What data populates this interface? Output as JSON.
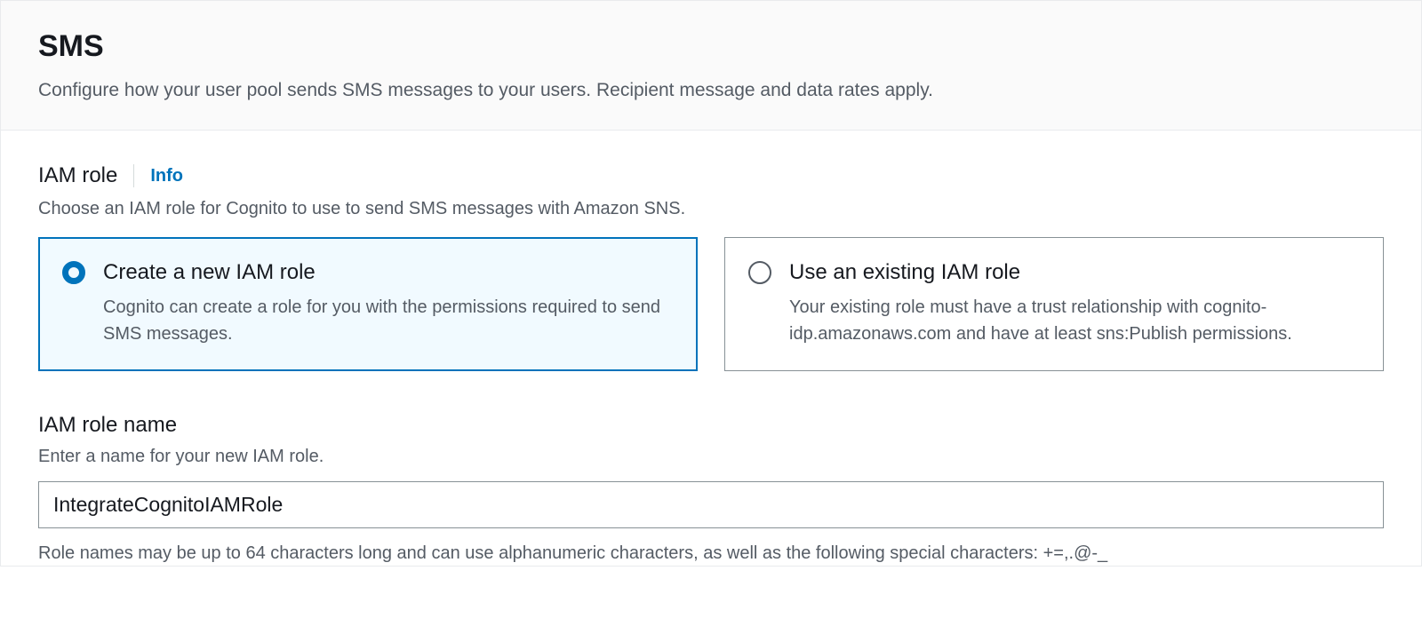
{
  "panel": {
    "title": "SMS",
    "subtitle": "Configure how your user pool sends SMS messages to your users. Recipient message and data rates apply."
  },
  "iam_role": {
    "heading": "IAM role",
    "info_label": "Info",
    "help": "Choose an IAM role for Cognito to use to send SMS messages with Amazon SNS.",
    "options": [
      {
        "title": "Create a new IAM role",
        "desc": "Cognito can create a role for you with the permissions required to send SMS messages.",
        "selected": true
      },
      {
        "title": "Use an existing IAM role",
        "desc": "Your existing role must have a trust relationship with cognito-idp.amazonaws.com and have at least sns:Publish permissions.",
        "selected": false
      }
    ]
  },
  "role_name": {
    "heading": "IAM role name",
    "help": "Enter a name for your new IAM role.",
    "value": "IntegrateCognitoIAMRole",
    "hint": "Role names may be up to 64 characters long and can use alphanumeric characters, as well as the following special characters: +=,.@-_"
  }
}
